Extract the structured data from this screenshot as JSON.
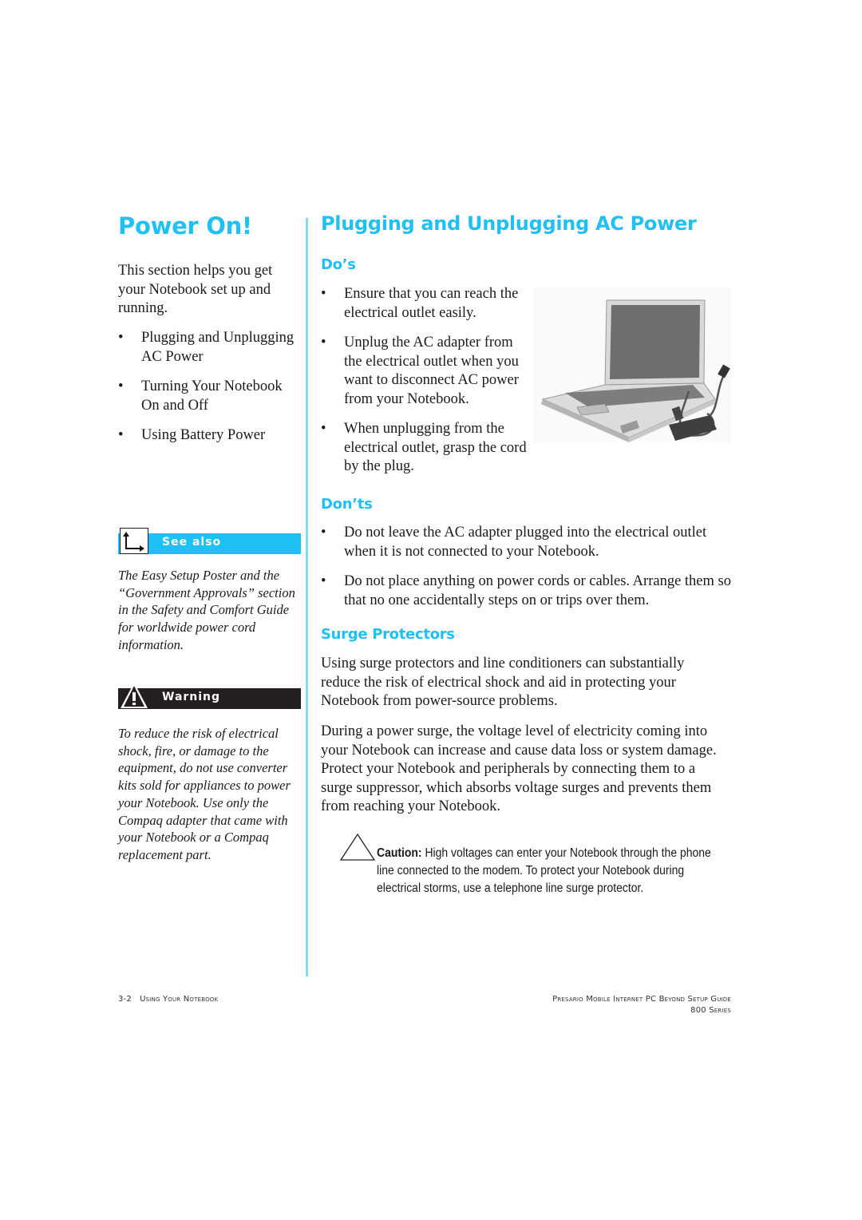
{
  "left_column": {
    "title": "Power On!",
    "intro": "This section helps you get your Notebook set up and running.",
    "topics": [
      "Plugging and Unplugging AC Power",
      "Turning Your Notebook On and Off",
      "Using Battery Power"
    ],
    "see_also": {
      "label": "See also",
      "icon": "see-also-arrow-icon",
      "text": "The Easy Setup Poster and the “Government Approvals” section in the Safety and Comfort Guide for worldwide power cord information."
    },
    "warning": {
      "label": "Warning",
      "icon": "warning-triangle-icon",
      "text": "To reduce the risk of electrical shock, fire, or damage to the equipment, do not use converter kits sold for appliances to power your Notebook. Use only the Compaq adapter that came with your Notebook or a Compaq replacement part."
    }
  },
  "main": {
    "title": "Plugging and Unplugging AC Power",
    "dos": {
      "heading": "Do’s",
      "items": [
        "Ensure that you can reach the electrical outlet easily.",
        "Unplug the AC adapter from the electrical outlet when you want to disconnect AC power from your Notebook.",
        "When unplugging from the electrical outlet, grasp the cord by the plug."
      ]
    },
    "donts": {
      "heading": "Don’ts",
      "items": [
        "Do not leave the AC adapter plugged into the electrical outlet when it is not connected to your Notebook.",
        "Do not place anything on power cords or cables. Arrange them so that no one accidentally steps on or trips over them."
      ]
    },
    "surge": {
      "heading": "Surge Protectors",
      "paragraphs": [
        "Using surge protectors and line conditioners can substantially reduce the risk of electrical shock and aid in protecting your Notebook from power-source problems.",
        "During a power surge, the voltage level of electricity coming into your Notebook can increase and cause data loss or system damage. Protect your Notebook and peripherals by connecting them to a surge suppressor, which absorbs voltage surges and prevents them from reaching your Notebook."
      ]
    },
    "caution": {
      "label": "Caution:",
      "text": " High voltages can enter your Notebook through the phone line connected to the modem. To protect your Notebook during electrical storms, use a telephone line surge protector."
    },
    "image_alt": "Notebook computer with AC adapter connected"
  },
  "bullet": "•",
  "footer": {
    "page": "3-2",
    "section": "Using Your Notebook",
    "guide": "Presario Mobile Internet PC Beyond Setup Guide",
    "series": "800 Series"
  }
}
